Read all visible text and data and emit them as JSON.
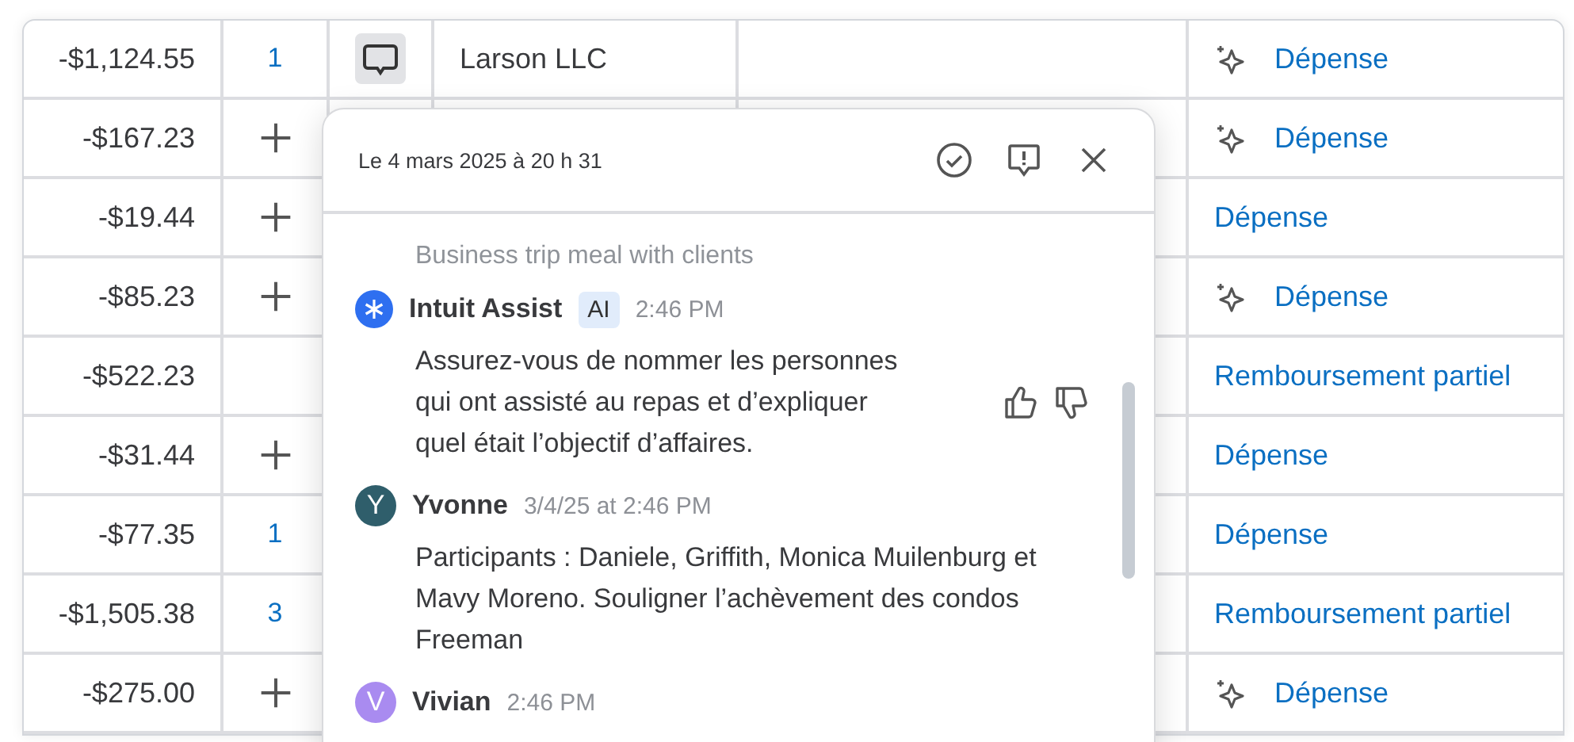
{
  "rows": [
    {
      "amount": "-$1,124.55",
      "count": {
        "kind": "number",
        "text": "1"
      },
      "has_comment": true,
      "payee": "Larson LLC",
      "category": "Dépense",
      "ai_suggested": true
    },
    {
      "amount": "-$167.23",
      "count": {
        "kind": "add"
      },
      "has_comment": false,
      "category": "Dépense",
      "ai_suggested": true
    },
    {
      "amount": "-$19.44",
      "count": {
        "kind": "add"
      },
      "has_comment": false,
      "category": "Dépense",
      "ai_suggested": false
    },
    {
      "amount": "-$85.23",
      "count": {
        "kind": "add"
      },
      "has_comment": false,
      "category": "Dépense",
      "ai_suggested": true
    },
    {
      "amount": "-$522.23",
      "has_comment": false,
      "category": "Remboursement partiel",
      "ai_suggested": false
    },
    {
      "amount": "-$31.44",
      "count": {
        "kind": "add"
      },
      "has_comment": false,
      "category": "Dépense",
      "ai_suggested": false
    },
    {
      "amount": "-$77.35",
      "count": {
        "kind": "number",
        "text": "1"
      },
      "has_comment": false,
      "category": "Dépense",
      "ai_suggested": false
    },
    {
      "amount": "-$1,505.38",
      "count": {
        "kind": "number",
        "text": "3"
      },
      "has_comment": false,
      "category": "Remboursement partiel",
      "ai_suggested": false
    },
    {
      "amount": "-$275.00",
      "count": {
        "kind": "add"
      },
      "has_comment": false,
      "category": "Dépense",
      "ai_suggested": true
    }
  ],
  "popover": {
    "date": "Le 4 mars 2025 à 20 h 31",
    "faded_text": "Business trip meal with clients",
    "messages": [
      {
        "kind": "ai",
        "author": "Intuit Assist",
        "badge": "AI",
        "time": "2:46 PM",
        "text": "Assurez-vous de nommer les personnes qui ont assisté au repas et d’expliquer quel était l’objectif d’affaires."
      },
      {
        "kind": "user",
        "author": "Yvonne",
        "initial": "Y",
        "color": "#2f5e6b",
        "time": "3/4/25 at 2:46 PM",
        "text": "Participants : Daniele, Griffith, Monica Muilenburg et Mavy Moreno. Souligner l’achèvement des condos Freeman"
      },
      {
        "kind": "user",
        "author": "Vivian",
        "initial": "V",
        "color": "#a98bf0",
        "time": "2:46 PM"
      }
    ]
  }
}
